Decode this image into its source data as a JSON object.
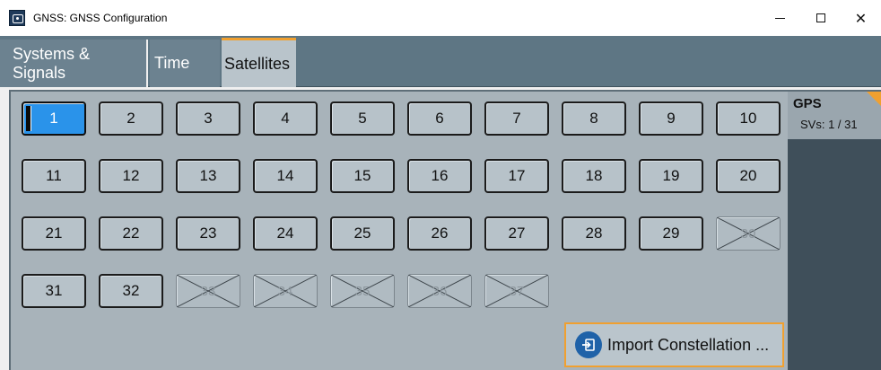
{
  "window": {
    "title": "GNSS: GNSS Configuration",
    "controls": {
      "minimize": "minimize",
      "maximize": "maximize",
      "close": "✕"
    }
  },
  "tabs": [
    {
      "label": "Systems & Signals",
      "active": false
    },
    {
      "label": "Time",
      "active": false
    },
    {
      "label": "Satellites",
      "active": true
    }
  ],
  "satellites": {
    "items": [
      {
        "label": "1",
        "state": "active"
      },
      {
        "label": "2",
        "state": "enabled"
      },
      {
        "label": "3",
        "state": "enabled"
      },
      {
        "label": "4",
        "state": "enabled"
      },
      {
        "label": "5",
        "state": "enabled"
      },
      {
        "label": "6",
        "state": "enabled"
      },
      {
        "label": "7",
        "state": "enabled"
      },
      {
        "label": "8",
        "state": "enabled"
      },
      {
        "label": "9",
        "state": "enabled"
      },
      {
        "label": "10",
        "state": "enabled"
      },
      {
        "label": "11",
        "state": "enabled"
      },
      {
        "label": "12",
        "state": "enabled"
      },
      {
        "label": "13",
        "state": "enabled"
      },
      {
        "label": "14",
        "state": "enabled"
      },
      {
        "label": "15",
        "state": "enabled"
      },
      {
        "label": "16",
        "state": "enabled"
      },
      {
        "label": "17",
        "state": "enabled"
      },
      {
        "label": "18",
        "state": "enabled"
      },
      {
        "label": "19",
        "state": "enabled"
      },
      {
        "label": "20",
        "state": "enabled"
      },
      {
        "label": "21",
        "state": "enabled"
      },
      {
        "label": "22",
        "state": "enabled"
      },
      {
        "label": "23",
        "state": "enabled"
      },
      {
        "label": "24",
        "state": "enabled"
      },
      {
        "label": "25",
        "state": "enabled"
      },
      {
        "label": "26",
        "state": "enabled"
      },
      {
        "label": "27",
        "state": "enabled"
      },
      {
        "label": "28",
        "state": "enabled"
      },
      {
        "label": "29",
        "state": "enabled"
      },
      {
        "label": "30",
        "state": "disabled"
      },
      {
        "label": "31",
        "state": "enabled"
      },
      {
        "label": "32",
        "state": "enabled"
      },
      {
        "label": "33",
        "state": "disabled"
      },
      {
        "label": "34",
        "state": "disabled"
      },
      {
        "label": "35",
        "state": "disabled"
      },
      {
        "label": "36",
        "state": "disabled"
      },
      {
        "label": "37",
        "state": "disabled"
      }
    ]
  },
  "gps_panel": {
    "system": "GPS",
    "svs": "SVs: 1 / 31"
  },
  "import_button": {
    "label": "Import Constellation ..."
  },
  "colors": {
    "accent": "#f0a030",
    "active_sv": "#2a93ea",
    "tab_bg": "#5e7684",
    "content_bg": "#a8b3ba"
  }
}
